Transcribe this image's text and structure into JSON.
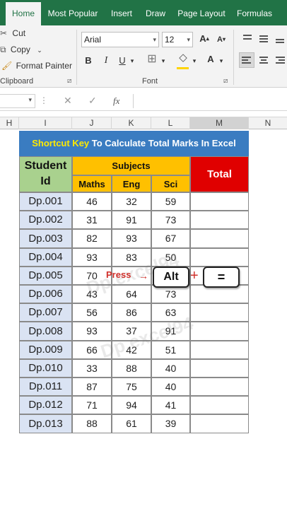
{
  "ribbon_tabs": [
    "Home",
    "Most Popular",
    "Insert",
    "Draw",
    "Page Layout",
    "Formulas"
  ],
  "clipboard": {
    "cut": "Cut",
    "copy": "Copy",
    "format_painter": "Format Painter",
    "group_label": "Clipboard"
  },
  "font": {
    "name": "Arial",
    "size": "12",
    "group_label": "Font",
    "grow": "A",
    "shrink": "A",
    "bold": "B",
    "italic": "I",
    "underline": "U",
    "font_color": "A"
  },
  "formula_bar": {
    "cancel": "✕",
    "enter": "✓",
    "fx": "fx",
    "value": ""
  },
  "columns": [
    "H",
    "I",
    "J",
    "K",
    "L",
    "M",
    "N"
  ],
  "sheet": {
    "title_highlight": "Shortcut Key",
    "title_rest": " To Calculate Total Marks In Excel",
    "student_header_line1": "Student",
    "student_header_line2": "Id",
    "subjects_header": "Subjects",
    "subject_cols": [
      "Maths",
      "Eng",
      "Sci"
    ],
    "total_header": "Total",
    "rows": [
      {
        "id": "Dp.001",
        "maths": "46",
        "eng": "32",
        "sci": "59"
      },
      {
        "id": "Dp.002",
        "maths": "31",
        "eng": "91",
        "sci": "73"
      },
      {
        "id": "Dp.003",
        "maths": "82",
        "eng": "93",
        "sci": "67"
      },
      {
        "id": "Dp.004",
        "maths": "93",
        "eng": "83",
        "sci": "50"
      },
      {
        "id": "Dp.005",
        "maths": "70",
        "eng": "",
        "sci": ""
      },
      {
        "id": "Dp.006",
        "maths": "43",
        "eng": "64",
        "sci": "73"
      },
      {
        "id": "Dp.007",
        "maths": "56",
        "eng": "86",
        "sci": "63"
      },
      {
        "id": "Dp.008",
        "maths": "93",
        "eng": "37",
        "sci": "91"
      },
      {
        "id": "Dp.009",
        "maths": "66",
        "eng": "42",
        "sci": "51"
      },
      {
        "id": "Dp.010",
        "maths": "33",
        "eng": "88",
        "sci": "40"
      },
      {
        "id": "Dp.011",
        "maths": "87",
        "eng": "75",
        "sci": "40"
      },
      {
        "id": "Dp.012",
        "maths": "71",
        "eng": "94",
        "sci": "41"
      },
      {
        "id": "Dp.013",
        "maths": "88",
        "eng": "61",
        "sci": "39"
      }
    ]
  },
  "overlay": {
    "press": "Press",
    "key1": "Alt",
    "plus": "+",
    "key2": "="
  },
  "watermark": "Dp.excel94",
  "colors": {
    "ribbon_green": "#217346",
    "title_blue": "#3a7cc1",
    "title_highlight": "#ffea00",
    "student_green": "#a9d18e",
    "subjects_orange": "#ffc000",
    "total_red": "#e00000",
    "id_blue": "#dae3f3"
  },
  "icons": [
    "scissors-icon",
    "copy-icon",
    "paintbrush-icon",
    "bold-icon",
    "italic-icon",
    "underline-icon",
    "borders-icon",
    "fill-color-icon",
    "font-color-icon",
    "align-left-icon",
    "align-center-icon",
    "cancel-icon",
    "enter-icon",
    "fx-icon"
  ]
}
